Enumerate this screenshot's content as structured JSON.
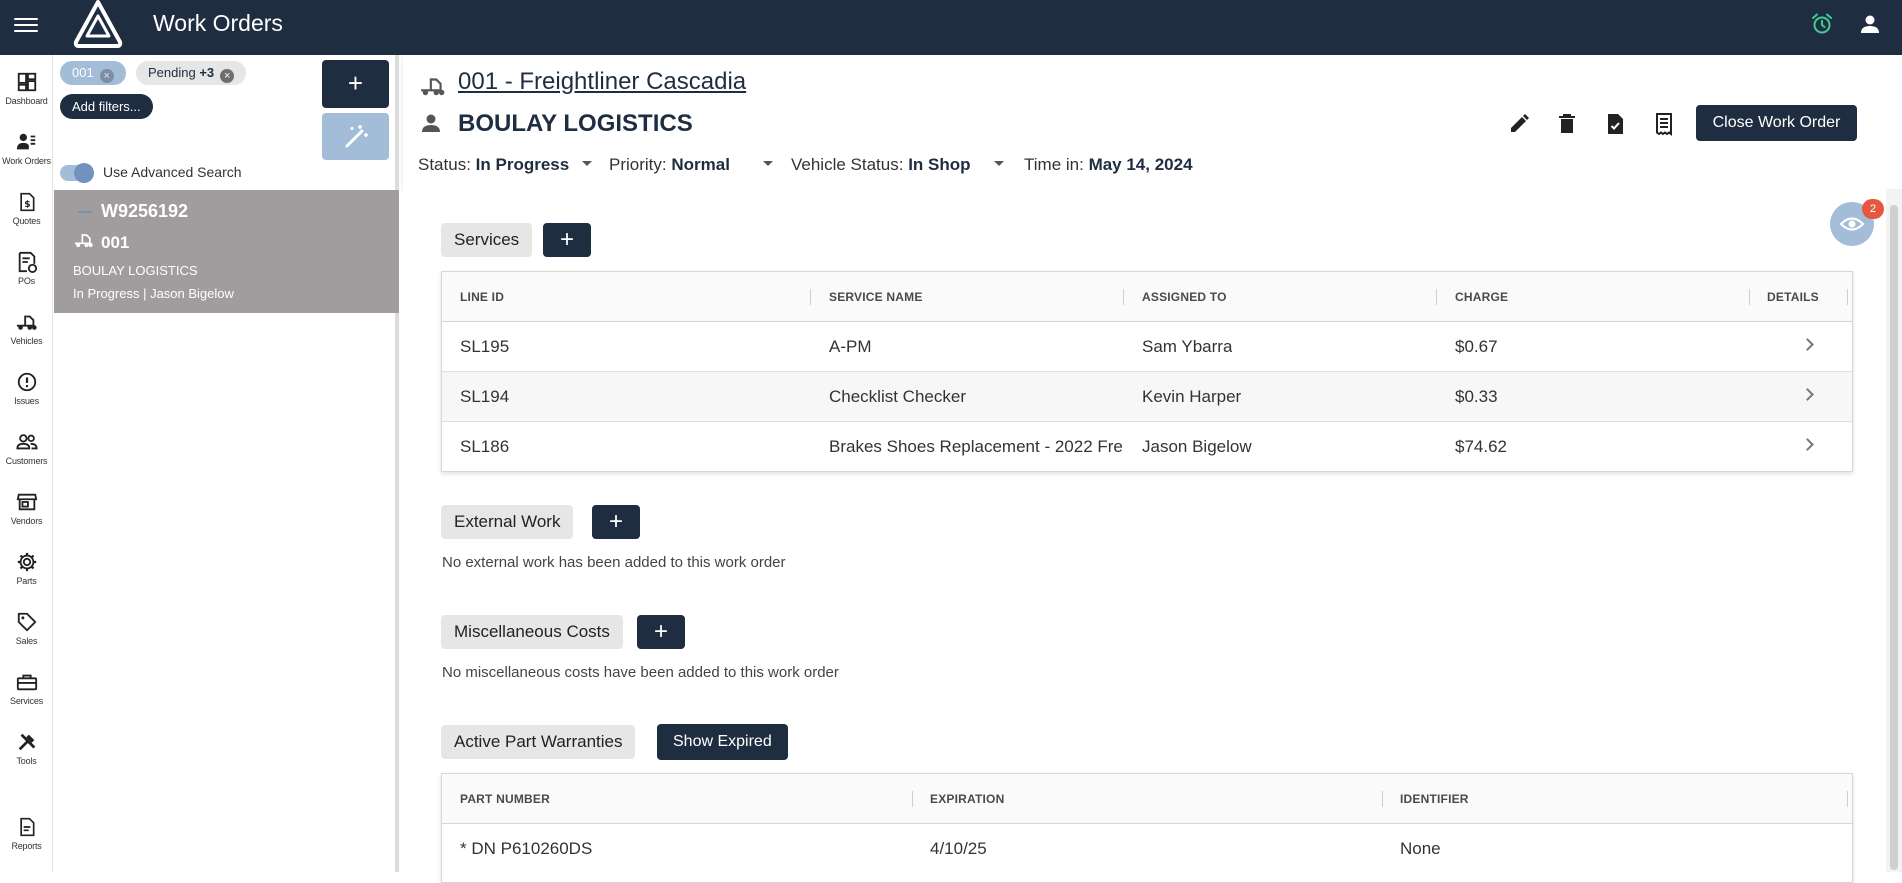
{
  "app": {
    "title": "Work Orders",
    "accent_color": "#1f2d40",
    "secondary_color": "#a3bcd8",
    "alarm_color": "#3ecf8e"
  },
  "topbar": {
    "menu_icon": "hamburger-menu-icon",
    "logo_icon": "triangle-logo-icon",
    "alarm_icon": "alarm-clock-icon",
    "user_icon": "account-icon"
  },
  "nav": {
    "items": [
      {
        "label": "Dashboard",
        "icon": "dashboard-icon"
      },
      {
        "label": "Work Orders",
        "icon": "work-orders-icon"
      },
      {
        "label": "Quotes",
        "icon": "quote-icon"
      },
      {
        "label": "POs",
        "icon": "purchase-order-icon"
      },
      {
        "label": "Vehicles",
        "icon": "truck-icon"
      },
      {
        "label": "Issues",
        "icon": "alert-circle-icon"
      },
      {
        "label": "Customers",
        "icon": "people-icon"
      },
      {
        "label": "Vendors",
        "icon": "storefront-icon"
      },
      {
        "label": "Parts",
        "icon": "gear-icon"
      },
      {
        "label": "Sales",
        "icon": "tag-icon"
      },
      {
        "label": "Services",
        "icon": "toolbox-icon"
      },
      {
        "label": "Tools",
        "icon": "tools-icon"
      },
      {
        "label": "Reports",
        "icon": "report-icon"
      }
    ]
  },
  "filters": {
    "chips": [
      {
        "label": "001"
      },
      {
        "label": "Pending",
        "extra": "+3"
      }
    ],
    "add_filters_label": "Add filters...",
    "advanced_search_label": "Use Advanced Search",
    "advanced_search_on": true
  },
  "list": {
    "selected": {
      "wo_number": "W9256192",
      "vehicle": "001",
      "customer": "BOULAY LOGISTICS",
      "status_line": "In Progress | Jason Bigelow"
    }
  },
  "header": {
    "vehicle_link": "001 - Freightliner Cascadia",
    "customer": "BOULAY LOGISTICS",
    "status_label": "Status:",
    "status_value": "In Progress",
    "priority_label": "Priority:",
    "priority_value": "Normal",
    "vehicle_status_label": "Vehicle Status:",
    "vehicle_status_value": "In Shop",
    "time_in_label": "Time in:",
    "time_in_value": "May 14, 2024",
    "actions": [
      "edit-icon",
      "delete-icon",
      "document-check-icon",
      "receipt-icon"
    ],
    "close_button": "Close Work Order"
  },
  "notifications": {
    "count": "2",
    "icon": "eye-icon"
  },
  "services": {
    "label": "Services",
    "columns": [
      "LINE ID",
      "SERVICE NAME",
      "ASSIGNED TO",
      "CHARGE",
      "DETAILS"
    ],
    "rows": [
      {
        "line_id": "SL195",
        "service": "A-PM",
        "assigned": "Sam Ybarra",
        "charge": "$0.67"
      },
      {
        "line_id": "SL194",
        "service": "Checklist Checker",
        "assigned": "Kevin Harper",
        "charge": "$0.33"
      },
      {
        "line_id": "SL186",
        "service": "Brakes Shoes Replacement - 2022 Fre",
        "assigned": "Jason Bigelow",
        "charge": "$74.62"
      }
    ]
  },
  "external_work": {
    "label": "External Work",
    "empty": "No external work has been added to this work order"
  },
  "misc_costs": {
    "label": "Miscellaneous Costs",
    "empty": "No miscellaneous costs have been added to this work order"
  },
  "warranties": {
    "label": "Active Part Warranties",
    "show_expired": "Show Expired",
    "columns": [
      "PART NUMBER",
      "EXPIRATION",
      "IDENTIFIER"
    ],
    "rows": [
      {
        "part": "* DN P610260DS",
        "expiration": "4/10/25",
        "identifier": "None"
      }
    ]
  }
}
